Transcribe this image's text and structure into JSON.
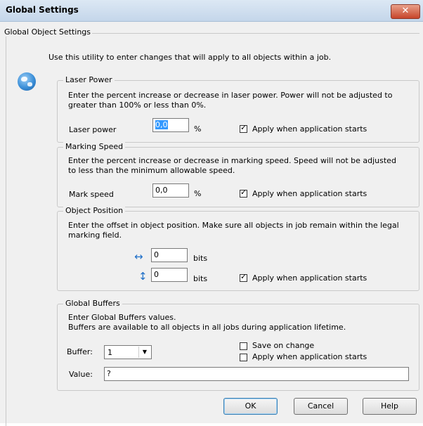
{
  "window": {
    "title": "Global Settings",
    "close_glyph": "✕"
  },
  "outer_group": {
    "legend": "Global Object Settings",
    "intro": "Use this utility to enter changes that will apply to all objects within a job.",
    "icon": "globe-icon"
  },
  "laser_power": {
    "legend": "Laser Power",
    "desc_line1": "Enter the percent increase or decrease in laser power.  Power will not be adjusted to",
    "desc_line2": "greater than 100% or less than 0%.",
    "label": "Laser power",
    "value": "0,0",
    "unit": "%",
    "apply_label": "Apply when application starts",
    "apply_checked": true
  },
  "marking_speed": {
    "legend": "Marking Speed",
    "desc_line1": "Enter the percent increase or decrease in marking speed.  Speed will not be adjusted",
    "desc_line2": "to less than the minimum allowable speed.",
    "label": "Mark speed",
    "value": "0,0",
    "unit": "%",
    "apply_label": "Apply when application starts",
    "apply_checked": true
  },
  "object_position": {
    "legend": "Object Position",
    "desc_line1": "Enter the offset in object position. Make sure all objects in job remain within the legal",
    "desc_line2": "marking field.",
    "x_value": "0",
    "y_value": "0",
    "unit": "bits",
    "apply_label": "Apply when application starts",
    "apply_checked": true
  },
  "global_buffers": {
    "legend": "Global Buffers",
    "desc_line1": "Enter Global Buffers values.",
    "desc_line2": "Buffers are available to all objects in all jobs during application lifetime.",
    "buffer_label": "Buffer:",
    "buffer_value": "1",
    "value_label": "Value:",
    "value": "?",
    "save_label": "Save on change",
    "save_checked": false,
    "apply_label": "Apply when application starts",
    "apply_checked": false
  },
  "buttons": {
    "ok": "OK",
    "cancel": "Cancel",
    "help": "Help"
  }
}
